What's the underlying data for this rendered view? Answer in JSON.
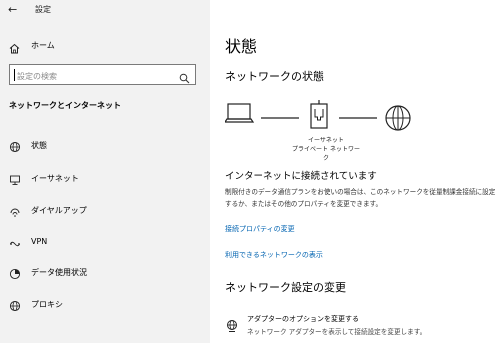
{
  "window": {
    "title": "設定"
  },
  "sidebar": {
    "home_label": "ホーム",
    "search_placeholder": "設定の検索",
    "section_heading": "ネットワークとインターネット",
    "items": [
      {
        "label": "状態",
        "icon": "globe-icon"
      },
      {
        "label": "イーサネット",
        "icon": "ethernet-icon"
      },
      {
        "label": "ダイヤルアップ",
        "icon": "dialup-icon"
      },
      {
        "label": "VPN",
        "icon": "vpn-icon"
      },
      {
        "label": "データ使用状況",
        "icon": "data-usage-icon"
      },
      {
        "label": "プロキシ",
        "icon": "globe-icon"
      }
    ]
  },
  "main": {
    "title": "状態",
    "network_status_heading": "ネットワークの状態",
    "diagram_label_line1": "イーサネット",
    "diagram_label_line2": "プライベート ネットワーク",
    "connection_title": "インターネットに接続されています",
    "connection_desc": "制限付きのデータ通信プランをお使いの場合は、このネットワークを従量制課金接続に設定するか、またはその他のプロパティを変更できます。",
    "link_properties": "接続プロパティの変更",
    "link_available": "利用できるネットワークの表示",
    "change_settings_heading": "ネットワーク設定の変更",
    "adapter_options_title": "アダプターのオプションを変更する",
    "adapter_options_desc": "ネットワーク アダプターを表示して接続設定を変更します。"
  },
  "colors": {
    "link": "#0063b1",
    "sidebar_bg": "#f2f2f2"
  }
}
